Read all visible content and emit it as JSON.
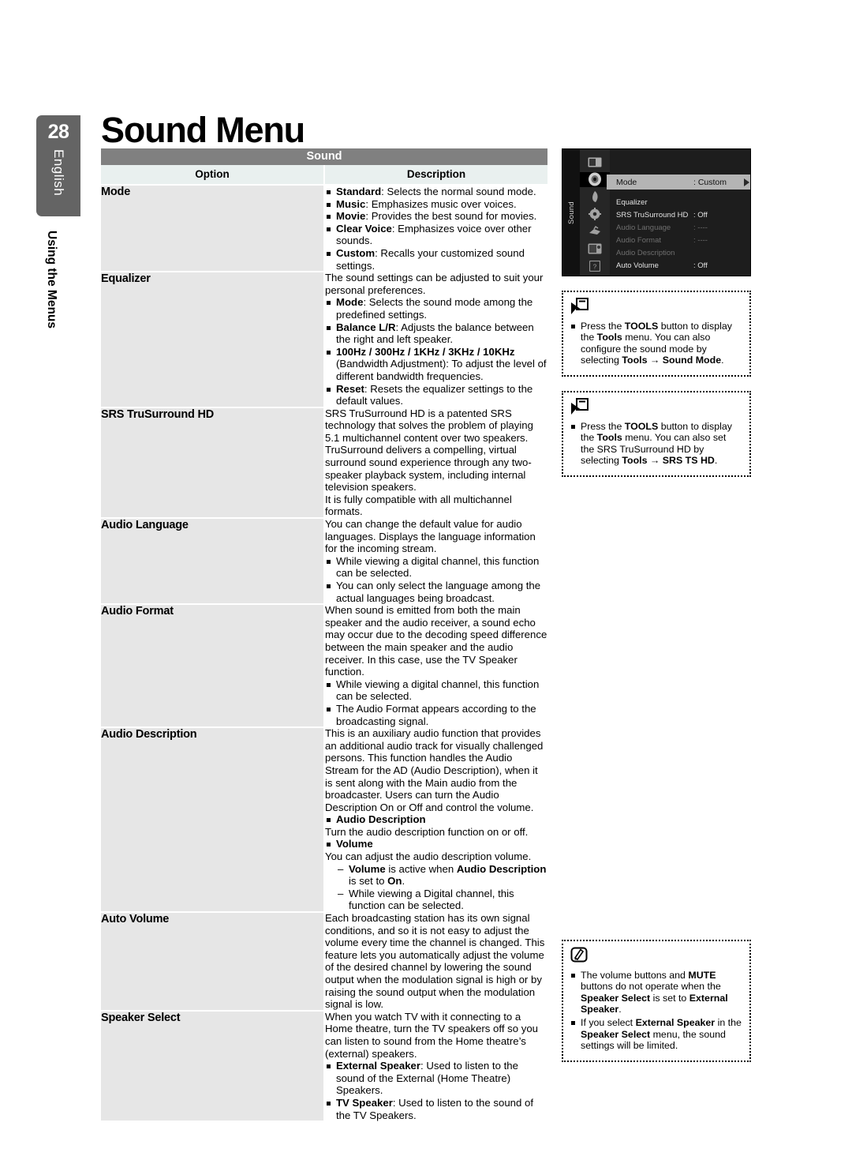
{
  "page": {
    "number": "28",
    "language": "English",
    "section": "Using the Menus",
    "title": "Sound Menu"
  },
  "table": {
    "title": "Sound",
    "columns": [
      "Option",
      "Description"
    ],
    "rows": [
      {
        "option": "Mode",
        "intro": [],
        "bullets": [
          {
            "lead": "Standard",
            "text": ": Selects the normal sound mode."
          },
          {
            "lead": "Music",
            "text": ": Emphasizes music over voices."
          },
          {
            "lead": "Movie",
            "text": ": Provides the best sound for movies."
          },
          {
            "lead": "Clear Voice",
            "text": ": Emphasizes voice over other sounds."
          },
          {
            "lead": "Custom",
            "text": ": Recalls your customized sound settings."
          }
        ]
      },
      {
        "option": "Equalizer",
        "intro": [
          "The sound settings can be adjusted to suit your personal preferences."
        ],
        "bullets": [
          {
            "lead": "Mode",
            "text": ": Selects the sound mode among the predefined settings."
          },
          {
            "lead": "Balance L/R",
            "text": ": Adjusts the balance between the right and left speaker."
          },
          {
            "lead": "100Hz / 300Hz / 1KHz / 3KHz / 10KHz",
            "text": " (Bandwidth Adjustment): To adjust the level of different bandwidth frequencies."
          },
          {
            "lead": "Reset",
            "text": ": Resets the equalizer settings to the default values."
          }
        ]
      },
      {
        "option": "SRS TruSurround HD",
        "intro": [
          "SRS TruSurround HD is a patented SRS technology that solves the problem of playing 5.1 multichannel content over two speakers. TruSurround delivers a compelling, virtual surround sound experience through any two-speaker playback system, including internal television speakers.",
          "It is fully compatible with all multichannel formats."
        ],
        "bullets": []
      },
      {
        "option": "Audio Language",
        "intro": [
          "You can change the default value for audio languages. Displays the language information for the incoming stream."
        ],
        "bullets": [
          {
            "lead": "",
            "text": "While viewing a digital channel, this function can be selected."
          },
          {
            "lead": "",
            "text": "You can only select the language among the actual languages being broadcast."
          }
        ]
      },
      {
        "option": "Audio Format",
        "intro": [
          "When sound is emitted from both the main speaker and the audio receiver, a sound echo may occur due to the decoding speed difference between the main speaker and the audio receiver. In this case, use the TV Speaker function."
        ],
        "bullets": [
          {
            "lead": "",
            "text": "While viewing a digital channel, this function can be selected."
          },
          {
            "lead": "",
            "text": "The Audio Format appears according to the broadcasting signal."
          }
        ]
      },
      {
        "option": "Audio Description",
        "intro": [
          "This is an auxiliary audio function that provides an additional audio track for visually challenged persons. This function handles the Audio Stream for the AD (Audio Description), when it is sent along with the Main audio from the broadcaster. Users can turn the Audio Description On or Off and control the volume."
        ],
        "bullets": [],
        "custom": true
      },
      {
        "option": "Auto Volume",
        "intro": [
          "Each broadcasting station has its own signal conditions, and so it is not easy to adjust the volume every time the channel is changed. This feature lets you automatically adjust the volume of the desired channel by lowering the sound output when the modulation signal is high or by raising the sound output when the modulation signal is low."
        ],
        "bullets": []
      },
      {
        "option": "Speaker Select",
        "intro": [
          "When you watch TV with it connecting to a Home theatre, turn the TV speakers off so you can listen to sound from the Home theatre’s (external) speakers."
        ],
        "bullets": [
          {
            "lead": "External Speaker",
            "text": ": Used to listen to the sound of the External (Home Theatre) Speakers."
          },
          {
            "lead": "TV Speaker",
            "text": ": Used to listen to the sound of the TV Speakers."
          }
        ]
      }
    ]
  },
  "audio_description_block": {
    "bullet1": "Audio Description",
    "line1": "Turn the audio description function on or off.",
    "bullet2": "Volume",
    "line2": "You can adjust the audio description volume.",
    "dash1_a": "Volume",
    "dash1_b": " is active when ",
    "dash1_c": "Audio Description",
    "dash1_d": " is set to ",
    "dash1_e": "On",
    "dash1_f": ".",
    "dash2": "While viewing a Digital channel, this function can be selected."
  },
  "tv_osd": {
    "rail_label": "Sound",
    "icons": [
      "picture-icon",
      "sound-icon",
      "channel-icon",
      "setup-icon",
      "input-icon",
      "application-icon",
      "support-icon"
    ],
    "items": [
      {
        "label": "Mode",
        "value": ": Custom",
        "state": "selected"
      },
      {
        "label": "Equalizer",
        "value": "",
        "state": "normal"
      },
      {
        "label": "SRS TruSurround HD",
        "value": ": Off",
        "state": "normal"
      },
      {
        "label": "Audio Language",
        "value": ": ----",
        "state": "dim"
      },
      {
        "label": "Audio Format",
        "value": ": ----",
        "state": "dim"
      },
      {
        "label": "Audio Description",
        "value": "",
        "state": "dim"
      },
      {
        "label": "Auto Volume",
        "value": ": Off",
        "state": "normal"
      }
    ]
  },
  "notes": [
    {
      "icon": "tools-icon",
      "lines": [
        {
          "segments": [
            {
              "t": "Press the ",
              "b": false
            },
            {
              "t": "TOOLS",
              "b": true
            },
            {
              "t": " button to display the ",
              "b": false
            },
            {
              "t": "Tools",
              "b": true
            },
            {
              "t": " menu. You can also configure the sound mode by selecting ",
              "b": false
            },
            {
              "t": "Tools → Sound Mode",
              "b": true
            },
            {
              "t": ".",
              "b": false
            }
          ]
        }
      ]
    },
    {
      "icon": "tools-icon",
      "lines": [
        {
          "segments": [
            {
              "t": "Press the ",
              "b": false
            },
            {
              "t": "TOOLS",
              "b": true
            },
            {
              "t": " button to display the ",
              "b": false
            },
            {
              "t": "Tools",
              "b": true
            },
            {
              "t": " menu. You can also set the SRS TruSurround HD by selecting ",
              "b": false
            },
            {
              "t": "Tools → SRS TS HD",
              "b": true
            },
            {
              "t": ".",
              "b": false
            }
          ]
        }
      ]
    },
    {
      "icon": "note-pencil-icon",
      "lines": [
        {
          "segments": [
            {
              "t": "The volume buttons and ",
              "b": false
            },
            {
              "t": "MUTE",
              "b": true
            },
            {
              "t": " buttons do not operate when the ",
              "b": false
            },
            {
              "t": "Speaker Select",
              "b": true
            },
            {
              "t": " is set to ",
              "b": false
            },
            {
              "t": "External Speaker",
              "b": true
            },
            {
              "t": ".",
              "b": false
            }
          ]
        },
        {
          "segments": [
            {
              "t": "If you select ",
              "b": false
            },
            {
              "t": "External Speaker",
              "b": true
            },
            {
              "t": " in the ",
              "b": false
            },
            {
              "t": "Speaker Select",
              "b": true
            },
            {
              "t": " menu, the sound settings will be limited.",
              "b": false
            }
          ]
        }
      ]
    }
  ]
}
